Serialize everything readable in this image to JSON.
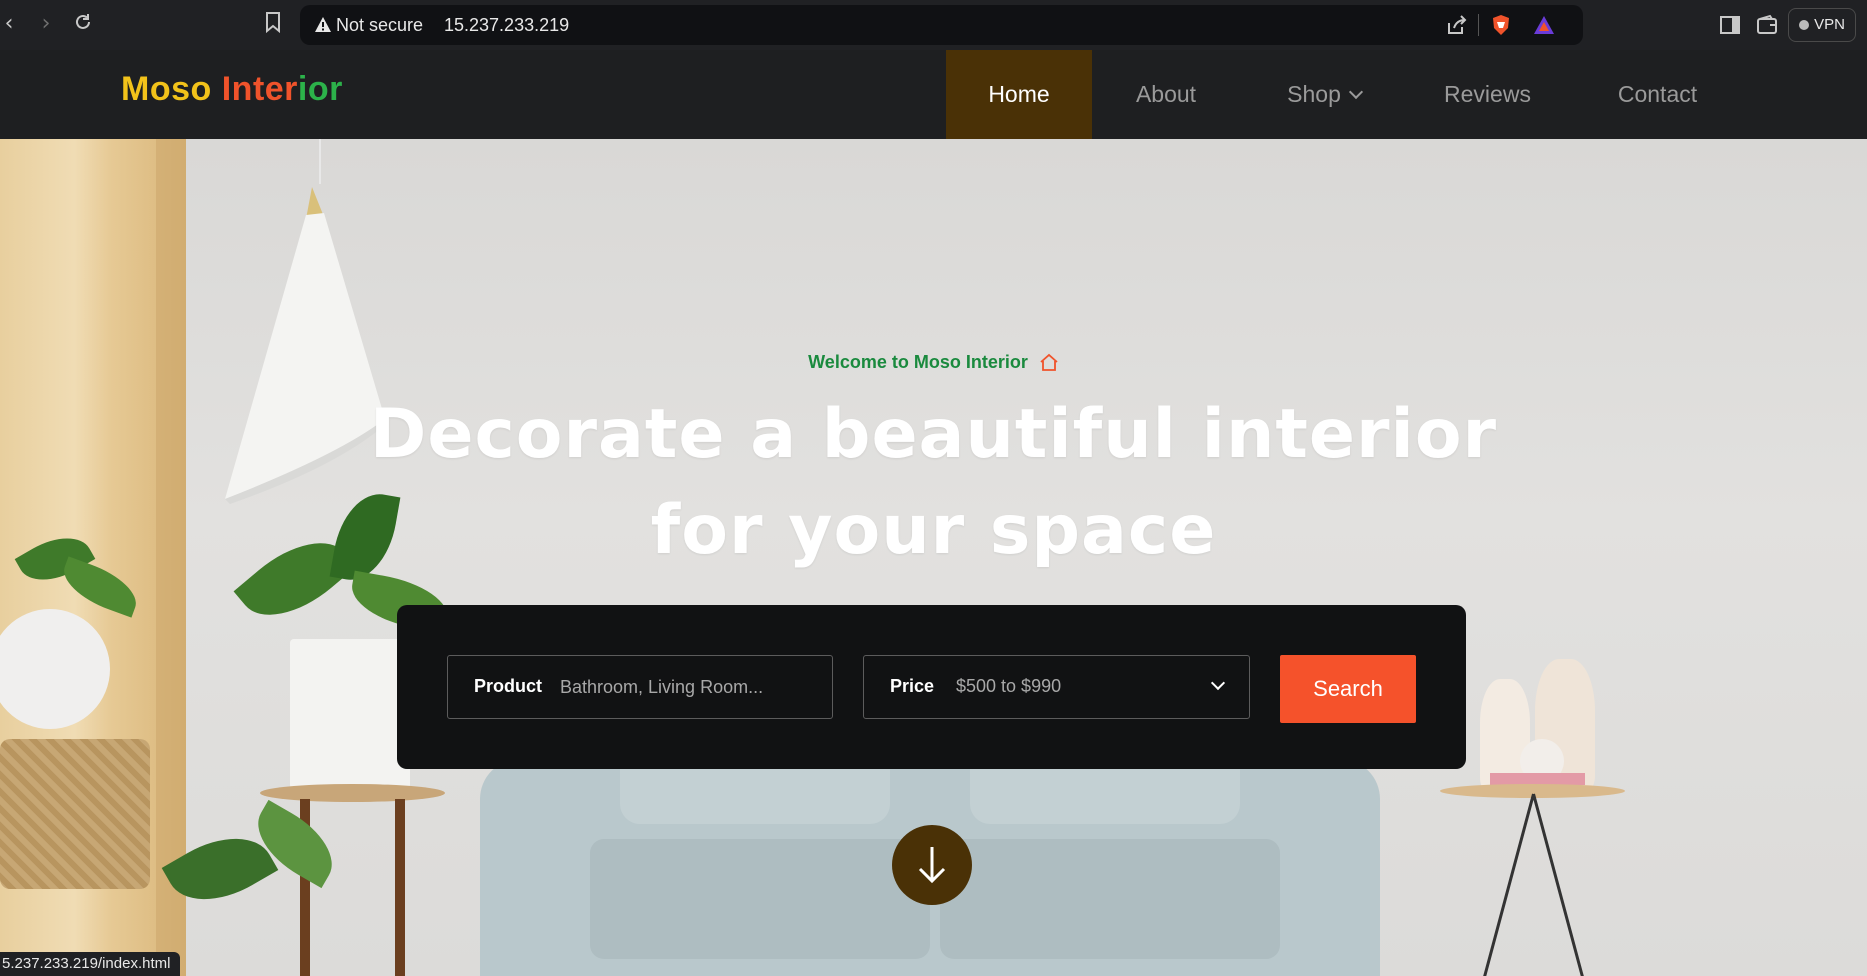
{
  "browser": {
    "security_label": "Not secure",
    "url": "15.237.233.219",
    "vpn_label": "VPN",
    "status_url": "5.237.233.219/index.html"
  },
  "site": {
    "logo": {
      "part1": "Moso",
      "part2a": "Inter",
      "part2b": "ior"
    },
    "nav": [
      {
        "label": "Home",
        "active": true
      },
      {
        "label": "About"
      },
      {
        "label": "Shop",
        "has_dropdown": true
      },
      {
        "label": "Reviews"
      },
      {
        "label": "Contact"
      }
    ]
  },
  "hero": {
    "eyebrow": "Welcome to Moso Interior",
    "headline_line1": "Decorate a beautiful interior",
    "headline_line2": "for your space",
    "search": {
      "product_label": "Product",
      "product_placeholder": "Bathroom, Living Room...",
      "price_label": "Price",
      "price_value": "$500 to $990",
      "button_label": "Search"
    }
  },
  "colors": {
    "accent_orange": "#f5522b",
    "nav_active_bg": "#4a3106",
    "eyebrow_green": "#1a8a3e",
    "logo_yellow": "#f2c21a",
    "logo_red": "#f0532b",
    "logo_green": "#2cb24a"
  }
}
